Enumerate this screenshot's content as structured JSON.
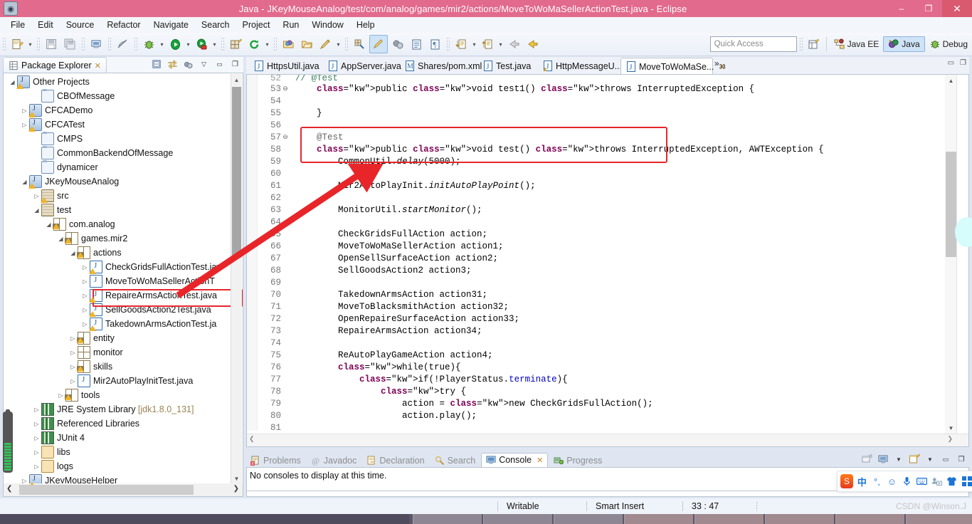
{
  "window": {
    "title": "Java - JKeyMouseAnalog/test/com/analog/games/mir2/actions/MoveToWoMaSellerActionTest.java - Eclipse",
    "app_icon": "eclipse-icon",
    "minimize": "–",
    "maximize": "❐",
    "close": "✕"
  },
  "menubar": {
    "items": [
      "File",
      "Edit",
      "Source",
      "Refactor",
      "Navigate",
      "Search",
      "Project",
      "Run",
      "Window",
      "Help"
    ]
  },
  "toolbar": {
    "quick_access_placeholder": "Quick Access",
    "perspectives": [
      {
        "label": "Java EE",
        "icon": "java-ee-perspective-icon",
        "active": false
      },
      {
        "label": "Java",
        "icon": "java-perspective-icon",
        "active": true
      },
      {
        "label": "Debug",
        "icon": "debug-perspective-icon",
        "active": false
      }
    ],
    "open_perspective_icon": "open-perspective-icon"
  },
  "package_explorer": {
    "title": "Package Explorer",
    "close_glyph": "✕",
    "tools": [
      "collapse-all-icon",
      "link-with-editor-icon",
      "view-menu-icon",
      "minimize-icon",
      "maximize-icon"
    ],
    "tree": [
      {
        "label": "Other Projects",
        "depth": 0,
        "twisty": "▲",
        "icon": "projects-icon",
        "warn": true
      },
      {
        "label": "CBOfMessage",
        "depth": 2,
        "twisty": "",
        "icon": "folder-icon",
        "warn": false
      },
      {
        "label": "CFCADemo",
        "depth": 1,
        "twisty": "▶",
        "icon": "project-icon",
        "warn": true
      },
      {
        "label": "CFCATest",
        "depth": 1,
        "twisty": "▶",
        "icon": "project-icon",
        "warn": true
      },
      {
        "label": "CMPS",
        "depth": 2,
        "twisty": "",
        "icon": "folder-icon",
        "warn": false
      },
      {
        "label": "CommonBackendOfMessage",
        "depth": 2,
        "twisty": "",
        "icon": "folder-icon",
        "warn": false
      },
      {
        "label": "dynamicer",
        "depth": 2,
        "twisty": "",
        "icon": "folder-icon",
        "warn": false
      },
      {
        "label": "JKeyMouseAnalog",
        "depth": 1,
        "twisty": "▲",
        "icon": "project-icon",
        "warn": true
      },
      {
        "label": "src",
        "depth": 2,
        "twisty": "▶",
        "icon": "source-folder-icon",
        "warn": true
      },
      {
        "label": "test",
        "depth": 2,
        "twisty": "▲",
        "icon": "source-folder-icon",
        "warn": false
      },
      {
        "label": "com.analog",
        "depth": 3,
        "twisty": "▲",
        "icon": "package-icon",
        "warn": true
      },
      {
        "label": "games.mir2",
        "depth": 4,
        "twisty": "▲",
        "icon": "package-icon",
        "warn": true
      },
      {
        "label": "actions",
        "depth": 5,
        "twisty": "▲",
        "icon": "package-icon",
        "warn": true
      },
      {
        "label": "CheckGridsFullActionTest.jav",
        "depth": 6,
        "twisty": "▶",
        "icon": "java-file-icon",
        "warn": true
      },
      {
        "label": "MoveToWoMaSellerActionT",
        "depth": 6,
        "twisty": "▶",
        "icon": "java-file-icon",
        "warn": false,
        "highlighted": true
      },
      {
        "label": "RepaireArmsActionTest.java",
        "depth": 6,
        "twisty": "▶",
        "icon": "java-file-icon",
        "warn": true
      },
      {
        "label": "SellGoodsAction2Test.java",
        "depth": 6,
        "twisty": "▶",
        "icon": "java-file-icon",
        "warn": true
      },
      {
        "label": "TakedownArmsActionTest.ja",
        "depth": 6,
        "twisty": "▶",
        "icon": "java-file-icon",
        "warn": true
      },
      {
        "label": "entity",
        "depth": 5,
        "twisty": "▶",
        "icon": "package-icon",
        "warn": true
      },
      {
        "label": "monitor",
        "depth": 5,
        "twisty": "▶",
        "icon": "package-icon",
        "warn": false
      },
      {
        "label": "skills",
        "depth": 5,
        "twisty": "▶",
        "icon": "package-icon",
        "warn": true
      },
      {
        "label": "Mir2AutoPlayInitTest.java",
        "depth": 5,
        "twisty": "▶",
        "icon": "java-file-icon",
        "warn": false
      },
      {
        "label": "tools",
        "depth": 4,
        "twisty": "▶",
        "icon": "package-icon",
        "warn": true
      },
      {
        "label": "JRE System Library [jdk1.8.0_131]",
        "depth": 2,
        "twisty": "▶",
        "icon": "library-icon",
        "warn": false
      },
      {
        "label": "Referenced Libraries",
        "depth": 2,
        "twisty": "▶",
        "icon": "library-icon",
        "warn": false
      },
      {
        "label": "JUnit 4",
        "depth": 2,
        "twisty": "▶",
        "icon": "library-icon",
        "warn": false
      },
      {
        "label": "libs",
        "depth": 2,
        "twisty": "▶",
        "icon": "open-folder-icon",
        "warn": false
      },
      {
        "label": "logs",
        "depth": 2,
        "twisty": "▶",
        "icon": "open-folder-icon",
        "warn": false
      },
      {
        "label": "JKeyMouseHelper",
        "depth": 1,
        "twisty": "▶",
        "icon": "project-icon",
        "warn": true
      }
    ]
  },
  "editor": {
    "tabs": [
      {
        "label": "HttpsUtil.java",
        "icon": "java-file-icon",
        "active": false,
        "warn": false
      },
      {
        "label": "AppServer.java",
        "icon": "java-file-icon",
        "active": false,
        "warn": false
      },
      {
        "label": "Shares/pom.xml",
        "icon": "maven-file-icon",
        "active": false,
        "warn": false
      },
      {
        "label": "Test.java",
        "icon": "java-file-icon",
        "active": false,
        "warn": false
      },
      {
        "label": "HttpMessageU...",
        "icon": "java-file-icon",
        "active": false,
        "warn": true
      },
      {
        "label": "MoveToWoMaSe...",
        "icon": "java-file-icon",
        "active": true,
        "warn": false,
        "close_glyph": "✕"
      }
    ],
    "overflow_label": "»",
    "overflow_count": "33",
    "minimize_glyph": "▭",
    "maximize_glyph": "❐",
    "lines": [
      {
        "num": "52",
        "fold": "",
        "text": "// @Test",
        "style": "cmt",
        "clipped": true
      },
      {
        "num": "53",
        "fold": "⊖",
        "text": "    public void test1() throws InterruptedException {"
      },
      {
        "num": "54",
        "fold": "",
        "text": ""
      },
      {
        "num": "55",
        "fold": "",
        "text": "    }"
      },
      {
        "num": "56",
        "fold": "",
        "text": ""
      },
      {
        "num": "57",
        "fold": "⊖",
        "text": "    @Test"
      },
      {
        "num": "58",
        "fold": "",
        "text": "    public void test() throws InterruptedException, AWTException {"
      },
      {
        "num": "59",
        "fold": "",
        "text": "        CommonUtil.delay(5000);"
      },
      {
        "num": "60",
        "fold": "",
        "text": ""
      },
      {
        "num": "61",
        "fold": "",
        "text": "        Mir2AutoPlayInit.initAutoPlayPoint();"
      },
      {
        "num": "62",
        "fold": "",
        "text": ""
      },
      {
        "num": "63",
        "fold": "",
        "text": "        MonitorUtil.startMonitor();"
      },
      {
        "num": "64",
        "fold": "",
        "text": ""
      },
      {
        "num": "65",
        "fold": "",
        "text": "        CheckGridsFullAction action;"
      },
      {
        "num": "66",
        "fold": "",
        "text": "        MoveToWoMaSellerAction action1;"
      },
      {
        "num": "67",
        "fold": "",
        "text": "        OpenSellSurfaceAction action2;"
      },
      {
        "num": "68",
        "fold": "",
        "text": "        SellGoodsAction2 action3;"
      },
      {
        "num": "69",
        "fold": "",
        "text": ""
      },
      {
        "num": "70",
        "fold": "",
        "text": "        TakedownArmsAction action31;"
      },
      {
        "num": "71",
        "fold": "",
        "text": "        MoveToBlacksmithAction action32;"
      },
      {
        "num": "72",
        "fold": "",
        "text": "        OpenRepaireSurfaceAction action33;"
      },
      {
        "num": "73",
        "fold": "",
        "text": "        RepaireArmsAction action34;"
      },
      {
        "num": "74",
        "fold": "",
        "text": ""
      },
      {
        "num": "75",
        "fold": "",
        "text": "        ReAutoPlayGameAction action4;"
      },
      {
        "num": "76",
        "fold": "",
        "text": "        while(true){"
      },
      {
        "num": "77",
        "fold": "",
        "text": "            if(!PlayerStatus.terminate){"
      },
      {
        "num": "78",
        "fold": "",
        "text": "                try {"
      },
      {
        "num": "79",
        "fold": "",
        "text": "                    action = new CheckGridsFullAction();"
      },
      {
        "num": "80",
        "fold": "",
        "text": "                    action.play();"
      },
      {
        "num": "81",
        "fold": "",
        "text": ""
      }
    ]
  },
  "bottom_panel": {
    "tabs": [
      {
        "label": "Problems",
        "icon": "problems-icon",
        "active": false
      },
      {
        "label": "Javadoc",
        "icon": "javadoc-icon",
        "active": false
      },
      {
        "label": "Declaration",
        "icon": "declaration-icon",
        "active": false
      },
      {
        "label": "Search",
        "icon": "search-icon",
        "active": false
      },
      {
        "label": "Console",
        "icon": "console-icon",
        "active": true,
        "close_glyph": "✕"
      },
      {
        "label": "Progress",
        "icon": "progress-icon",
        "active": false
      }
    ],
    "message": "No consoles to display at this time.",
    "tools": [
      "open-console-icon",
      "display-selected-console-icon",
      "chevron-down-icon",
      "new-console-view-icon",
      "chevron-down-icon",
      "minimize-icon",
      "maximize-icon"
    ]
  },
  "statusbar": {
    "writable": "Writable",
    "insert_mode": "Smart Insert",
    "cursor_position": "33 : 47"
  },
  "watermark": "CSDN @Winson.J",
  "ime": {
    "logo": "sogou-ime-logo",
    "mode": "中",
    "punct": "°,",
    "icons": [
      "emoji-icon",
      "microphone-icon",
      "keyboard-icon",
      "user-card-icon",
      "skin-icon",
      "apps-icon"
    ]
  },
  "annotations": {
    "highlight_color": "#e8262a",
    "arrow": "tree-to-code-arrow"
  }
}
